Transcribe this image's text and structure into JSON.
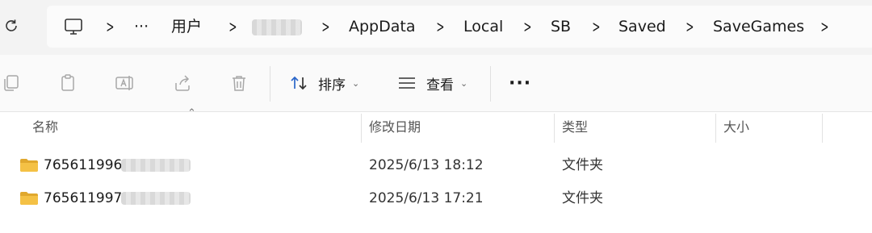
{
  "address_bar": {
    "crumbs": [
      "用户",
      "AppData",
      "Local",
      "SB",
      "Saved",
      "SaveGames"
    ],
    "ellipsis": "···"
  },
  "toolbar": {
    "sort_label": "排序",
    "view_label": "查看",
    "more_label": "···"
  },
  "columns": {
    "name": "名称",
    "date": "修改日期",
    "type": "类型",
    "size": "大小"
  },
  "files": [
    {
      "name": "765611996",
      "date": "2025/6/13 18:12",
      "type": "文件夹",
      "size": ""
    },
    {
      "name": "765611997",
      "date": "2025/6/13 17:21",
      "type": "文件夹",
      "size": ""
    }
  ],
  "colors": {
    "folder": "#f4c145",
    "folder_dark": "#e0a82e",
    "icon_gray": "#a8a8a8",
    "blue": "#2a66c9"
  }
}
